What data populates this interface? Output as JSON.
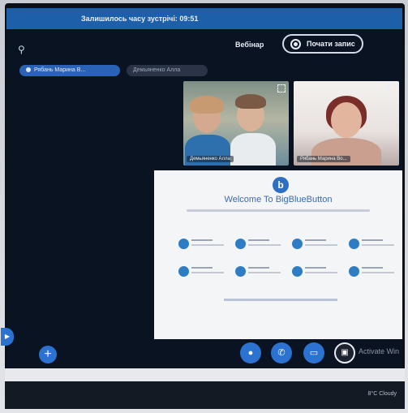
{
  "window": {
    "title": "Залишилось часу зустрічі: 09:51"
  },
  "header": {
    "webinar_label": "Вебінар",
    "record_label": "Почати запис"
  },
  "participants": [
    {
      "name": "Рябань Марина В..."
    },
    {
      "name": "Демьяненко Алла"
    }
  ],
  "videos": [
    {
      "name": "Демьяненко Алла"
    },
    {
      "name": "Рябань Марина Во..."
    }
  ],
  "presentation": {
    "logo_letter": "b",
    "welcome": "Welcome To BigBlueButton"
  },
  "weather": {
    "text": "8°C Cloudy"
  },
  "overlay": {
    "text": "Activate Win"
  },
  "icons": {
    "users": "users-icon",
    "record": "record-icon",
    "expand": "expand-icon",
    "plus": "plus-icon",
    "mic": "mic-icon",
    "phone": "phone-icon",
    "camera": "camera-icon",
    "screen_share": "screen-share-icon"
  },
  "colors": {
    "titlebar": "#1d5fa8",
    "accent": "#2b72d1",
    "app_bg": "#0a1322"
  }
}
